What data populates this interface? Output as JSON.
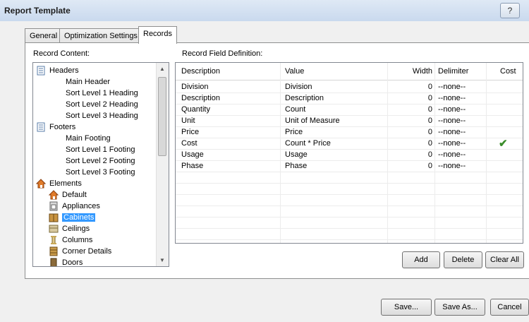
{
  "window": {
    "title": "Report Template",
    "help_label": "?"
  },
  "tabs": [
    {
      "label": "General",
      "active": false
    },
    {
      "label": "Optimization Settings",
      "active": false
    },
    {
      "label": "Records",
      "active": true
    }
  ],
  "record_content": {
    "label": "Record Content:",
    "tree": [
      {
        "label": "Headers",
        "level": 0,
        "icon": "document-icon"
      },
      {
        "label": "Main Header",
        "level": 1
      },
      {
        "label": "Sort Level 1 Heading",
        "level": 1
      },
      {
        "label": "Sort Level 2 Heading",
        "level": 1
      },
      {
        "label": "Sort Level 3 Heading",
        "level": 1
      },
      {
        "label": "Footers",
        "level": 0,
        "icon": "document-icon"
      },
      {
        "label": "Main Footing",
        "level": 1
      },
      {
        "label": "Sort Level 1 Footing",
        "level": 1
      },
      {
        "label": "Sort Level 2 Footing",
        "level": 1
      },
      {
        "label": "Sort Level 3 Footing",
        "level": 1
      },
      {
        "label": "Elements",
        "level": 0,
        "icon": "house-icon"
      },
      {
        "label": "Default",
        "level": 1,
        "icon": "house-icon"
      },
      {
        "label": "Appliances",
        "level": 1,
        "icon": "appliance-icon"
      },
      {
        "label": "Cabinets",
        "level": 1,
        "icon": "cabinet-icon",
        "selected": true
      },
      {
        "label": "Ceilings",
        "level": 1,
        "icon": "ceiling-icon"
      },
      {
        "label": "Columns",
        "level": 1,
        "icon": "column-icon"
      },
      {
        "label": "Corner Details",
        "level": 1,
        "icon": "corner-icon"
      },
      {
        "label": "Doors",
        "level": 1,
        "icon": "door-icon"
      }
    ]
  },
  "field_definition": {
    "label": "Record Field Definition:",
    "columns": [
      "Description",
      "Value",
      "Width",
      "Delimiter",
      "Cost"
    ],
    "rows": [
      {
        "description": "Division",
        "value": "Division",
        "width": "0",
        "delimiter": "--none--",
        "cost": false
      },
      {
        "description": "Description",
        "value": "Description",
        "width": "0",
        "delimiter": "--none--",
        "cost": false
      },
      {
        "description": "Quantity",
        "value": "Count",
        "width": "0",
        "delimiter": "--none--",
        "cost": false
      },
      {
        "description": "Unit",
        "value": "Unit of Measure",
        "width": "0",
        "delimiter": "--none--",
        "cost": false
      },
      {
        "description": "Price",
        "value": "Price",
        "width": "0",
        "delimiter": "--none--",
        "cost": false
      },
      {
        "description": "Cost",
        "value": "Count * Price",
        "width": "0",
        "delimiter": "--none--",
        "cost": true
      },
      {
        "description": "Usage",
        "value": "Usage",
        "width": "0",
        "delimiter": "--none--",
        "cost": false
      },
      {
        "description": "Phase",
        "value": "Phase",
        "width": "0",
        "delimiter": "--none--",
        "cost": false
      }
    ],
    "check_glyph": "✔"
  },
  "grid_buttons": {
    "add": "Add",
    "delete": "Delete",
    "clear_all": "Clear All"
  },
  "footer_buttons": {
    "save": "Save...",
    "save_as": "Save As...",
    "cancel": "Cancel"
  },
  "colors": {
    "selection": "#3399ff",
    "check": "#3a8c2a",
    "titlebar": "#c9d9ee"
  }
}
